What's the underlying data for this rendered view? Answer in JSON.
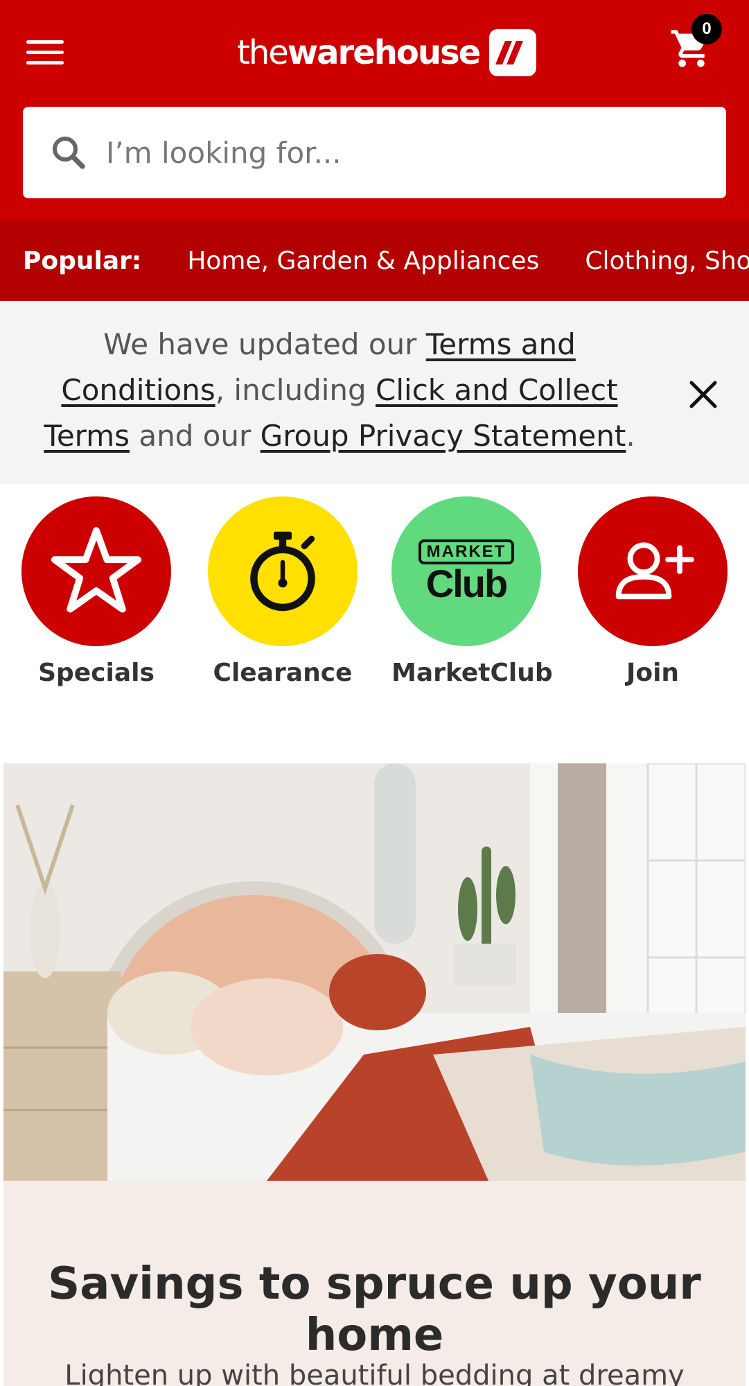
{
  "header": {
    "logo_the": "the",
    "logo_warehouse": "warehouse",
    "cart_count": "0",
    "search_placeholder": "I’m looking for..."
  },
  "popular": {
    "label": "Popular:",
    "links": [
      "Home, Garden & Appliances",
      "Clothing, Shoes & Accessories"
    ]
  },
  "notice": {
    "t1": "We have updated our ",
    "l1": "Terms and Conditions",
    "t2": ", including ",
    "l2": "Click and Collect Terms",
    "t3": " and our ",
    "l3": "Group Privacy Statement",
    "t4": "."
  },
  "quick_links": [
    {
      "label": "Specials",
      "color": "#cc0000",
      "icon": "star-icon"
    },
    {
      "label": "Clearance",
      "color": "#ffe000",
      "icon": "stopwatch-icon"
    },
    {
      "label": "MarketClub",
      "color": "#61d97e",
      "icon": "marketclub-icon",
      "badge_top": "MARKET",
      "badge_bottom": "Club"
    },
    {
      "label": "Join",
      "color": "#cc0000",
      "icon": "add-user-icon"
    }
  ],
  "promo": {
    "title": "Savings to spruce up your home",
    "body": "Lighten up with beautiful bedding at dreamy"
  },
  "colors": {
    "brand_red": "#cc0000",
    "strip_red": "#b30000",
    "notice_bg": "#f4f4f4",
    "promo_bg": "#f5ece7"
  }
}
